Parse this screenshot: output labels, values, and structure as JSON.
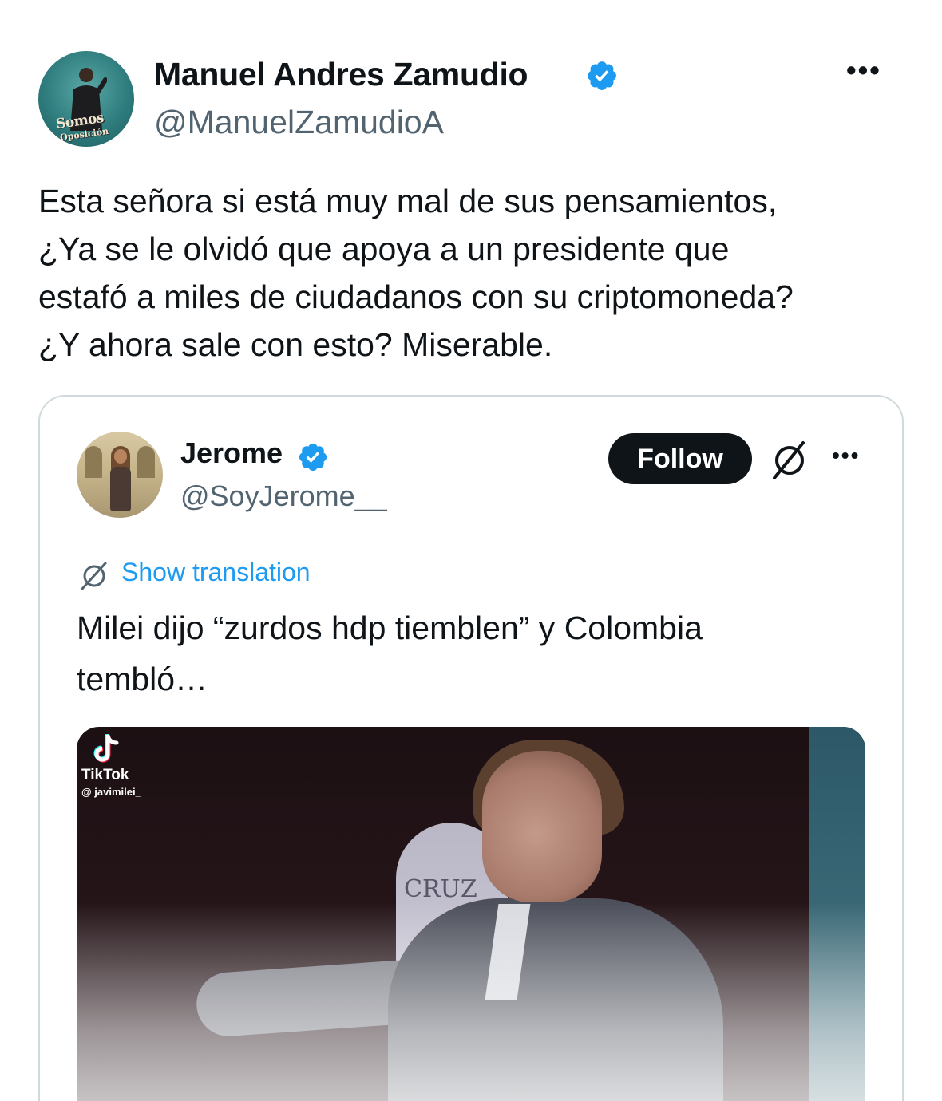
{
  "tweet": {
    "author_name": "Manuel Andres Zamudio",
    "author_handle": "@ManuelZamudioA",
    "avatar_text_1": "Somos",
    "avatar_text_2": "Oposición",
    "more_label": "•••",
    "text": "Esta señora si está muy mal de sus pensamientos,\n¿Ya se le olvidó que apoya a un presidente que\nestafó a miles de ciudadanos con su criptomoneda?\n¿Y ahora sale con esto? Miserable.",
    "icons": [
      "verified-badge-icon",
      "more-options-icon"
    ],
    "colors": {
      "verified": "#1d9bf0",
      "handle": "#536471",
      "text": "#0f1419"
    }
  },
  "quote": {
    "author_name": "Jerome",
    "author_handle": "@SoyJerome__",
    "follow_label": "Follow",
    "more_label": "•••",
    "show_translation_label": "Show translation",
    "text": "Milei dijo “zurdos hdp tiemblen” y Colombia\ntembló…",
    "media": {
      "tiktok_label": "TikTok",
      "tiktok_user": "@ javimilei_",
      "sign_text": "CRUZ"
    },
    "icons": [
      "verified-badge-icon",
      "translate-icon",
      "more-options-icon",
      "tiktok-logo-icon"
    ],
    "colors": {
      "follow_bg": "#0f1419",
      "link": "#1d9bf0",
      "border": "#cfd9de"
    }
  }
}
